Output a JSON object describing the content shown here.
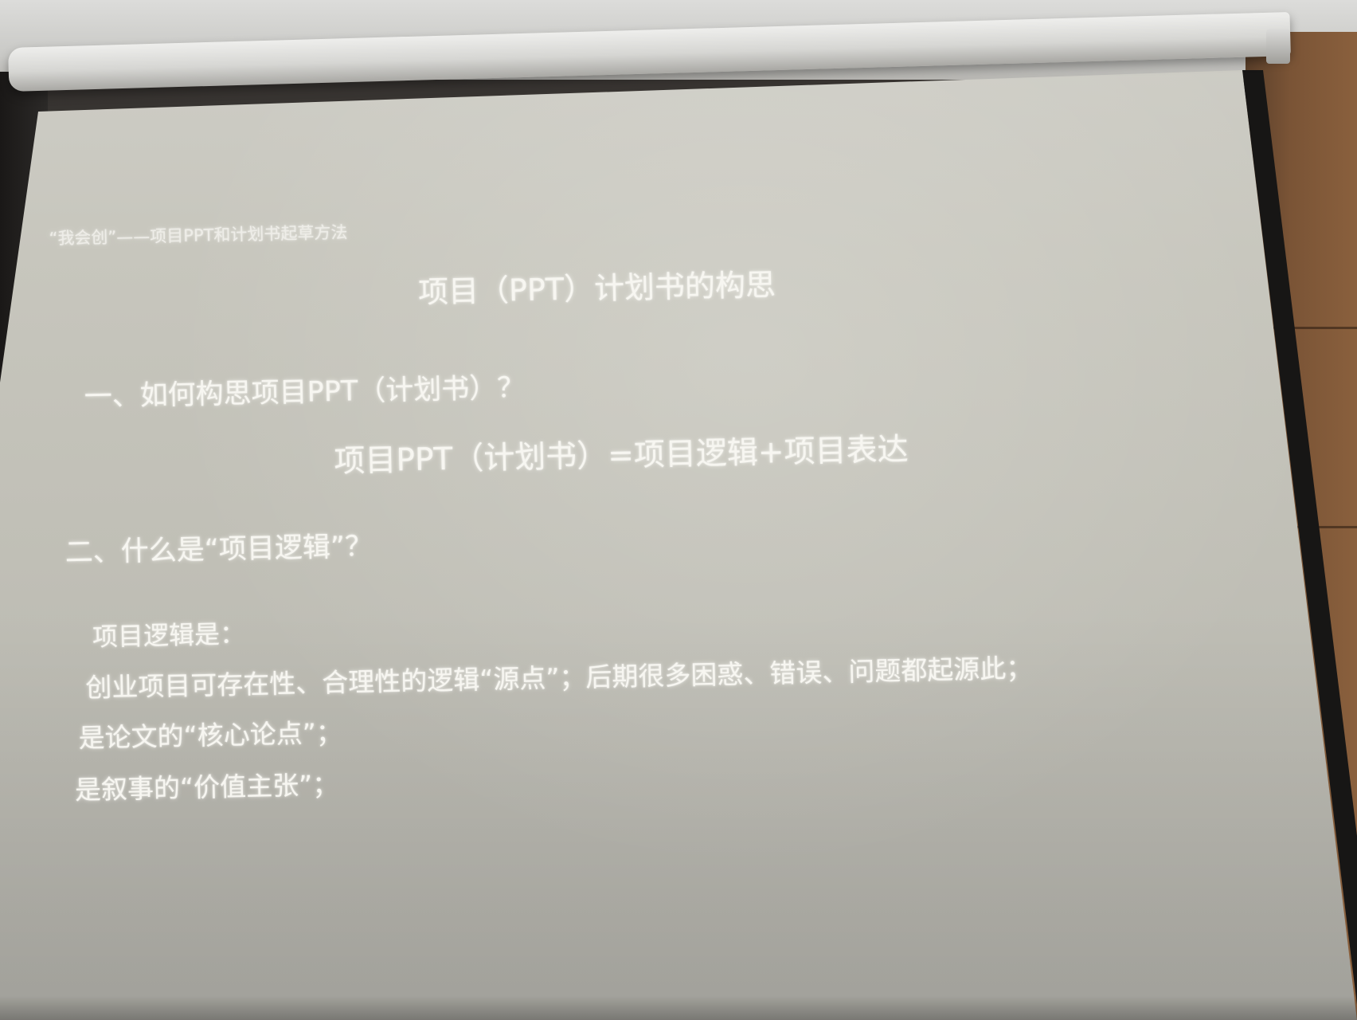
{
  "slide": {
    "header": "“我会创”——项目PPT和计划书起草方法",
    "title": "项目（PPT）计划书的构思",
    "section_one": {
      "question": "一、如何构思项目PPT（计划书）？",
      "formula": "项目PPT（计划书）=项目逻辑+项目表达"
    },
    "section_two": {
      "question": "二、什么是“项目逻辑”？",
      "lead": "项目逻辑是：",
      "points": [
        "创业项目可存在性、合理性的逻辑“源点”；后期很多困惑、错误、问题都起源此；",
        "是论文的“核心论点”；",
        "是叙事的“价值主张”；"
      ]
    }
  }
}
